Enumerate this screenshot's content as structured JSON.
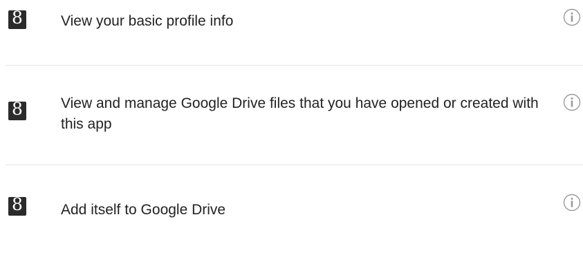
{
  "permissions": {
    "items": [
      {
        "icon": "google-plus-g-icon",
        "text": "View your basic profile info",
        "info_icon": "info-icon"
      },
      {
        "icon": "google-plus-g-icon",
        "text": "View and manage Google Drive files that you have opened or created with this app",
        "info_icon": "info-icon"
      },
      {
        "icon": "google-plus-g-icon",
        "text": "Add itself to Google Drive",
        "info_icon": "info-icon"
      }
    ],
    "icon_glyph": "8"
  },
  "colors": {
    "icon_background": "#2b2b2b",
    "text": "#222222",
    "divider": "#e5e5e5",
    "info_icon": "#9a9a9a"
  }
}
